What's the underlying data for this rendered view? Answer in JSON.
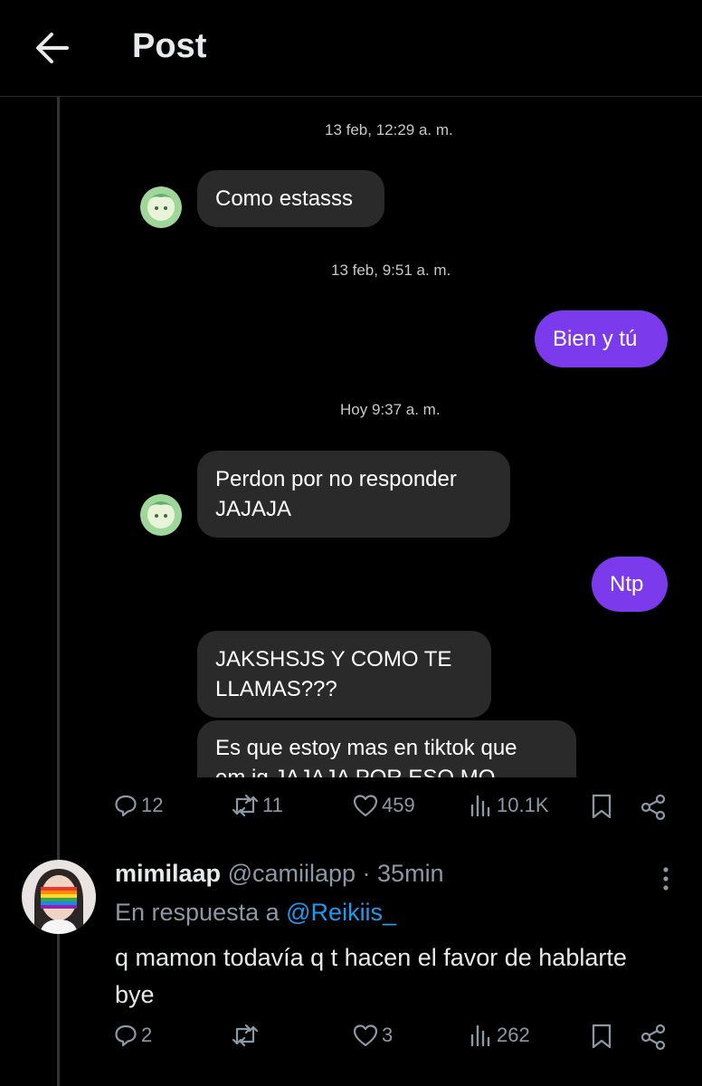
{
  "header": {
    "title": "Post",
    "back_icon": "arrow-left-icon"
  },
  "chat": {
    "messages": [
      {
        "type": "timestamp",
        "text": "13 feb, 12:29 a. m."
      },
      {
        "type": "incoming",
        "lines": [
          "Como estasss"
        ]
      },
      {
        "type": "timestamp",
        "text": "13 feb, 9:51 a. m."
      },
      {
        "type": "outgoing",
        "lines": [
          "Bien y tú"
        ]
      },
      {
        "type": "timestamp",
        "text": "Hoy 9:37 a. m."
      },
      {
        "type": "incoming",
        "lines": [
          "Perdon por no responder",
          "JAJAJA"
        ]
      },
      {
        "type": "outgoing",
        "lines": [
          "Ntp"
        ]
      },
      {
        "type": "incoming",
        "lines": [
          "JAKSHSJS Y COMO TE",
          "LLAMAS???"
        ]
      },
      {
        "type": "incoming",
        "lines": [
          "Es que estoy mas en tiktok que",
          "em ig JAJAJA POR ESO MQ"
        ]
      }
    ],
    "colors": {
      "incoming_bubble": "#2a2a2a",
      "outgoing_bubble": "#7c3aed"
    }
  },
  "post_actions": {
    "replies": "12",
    "reposts": "11",
    "likes": "459",
    "views": "10.1K"
  },
  "reply": {
    "display_name": "mimilaap",
    "handle": "@camiilapp",
    "time": "· 35min",
    "reply_prefix": "En respuesta a",
    "reply_to": "@Reikiis_",
    "text": "q mamon todavía q t hacen el favor de hablarte bye",
    "actions": {
      "replies": "2",
      "reposts": "",
      "likes": "3",
      "views": "262"
    }
  },
  "icons": [
    "arrow-left-icon",
    "reply-icon",
    "repost-icon",
    "like-icon",
    "views-icon",
    "bookmark-icon",
    "share-icon",
    "more-icon"
  ],
  "accent": "#1d9bf0"
}
